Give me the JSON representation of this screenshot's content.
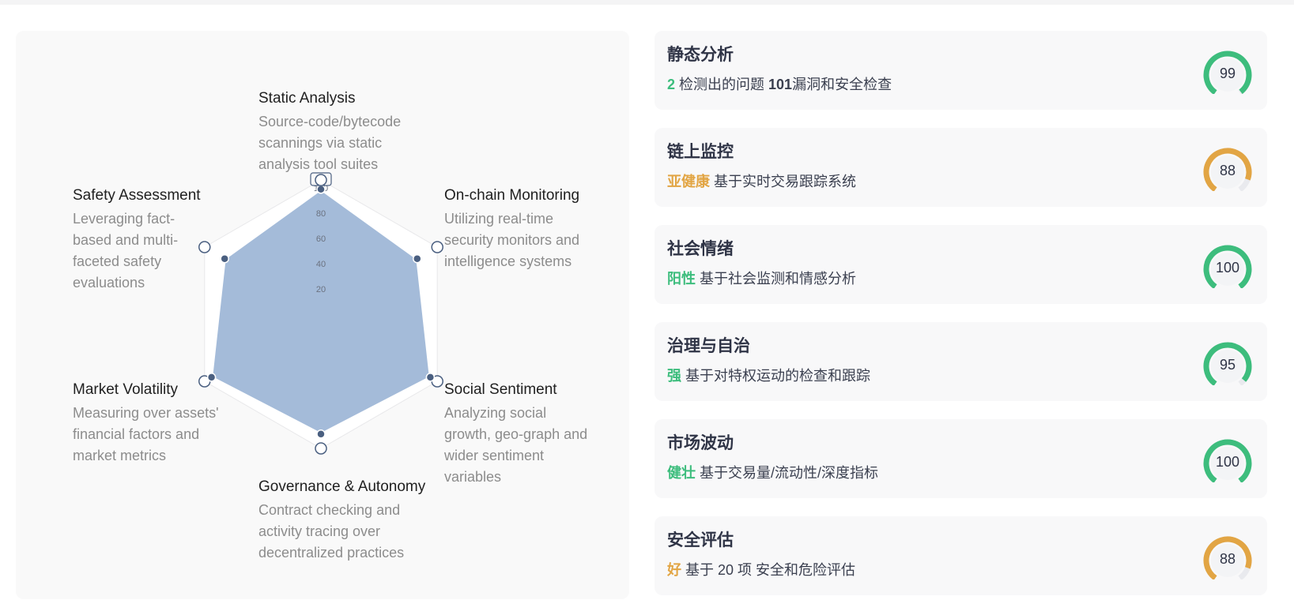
{
  "colors": {
    "green": "#3dbd7d",
    "orange": "#e2a544",
    "radar_fill": "#a4bbd9",
    "point": "#4a5f80"
  },
  "radar": {
    "scale_labels": [
      "20",
      "40",
      "60",
      "80",
      "100"
    ],
    "scale_max": 100,
    "dimensions": [
      {
        "title": "Static Analysis",
        "desc": [
          "Source-code/bytecode",
          "scannings via static",
          "analysis tool suites"
        ],
        "value": 99
      },
      {
        "title": "On-chain Monitoring",
        "desc": [
          "Utilizing real-time",
          "security monitors and",
          "intelligence systems"
        ],
        "value": 88
      },
      {
        "title": "Social Sentiment",
        "desc": [
          "Analyzing social",
          "growth, geo-graph and",
          "wider sentiment",
          "variables"
        ],
        "value": 100
      },
      {
        "title": "Governance & Autonomy",
        "desc": [
          "Contract checking and",
          "activity tracing over",
          "decentralized practices"
        ],
        "value": 95
      },
      {
        "title": "Market Volatility",
        "desc": [
          "Measuring over assets'",
          "financial factors and",
          "market metrics"
        ],
        "value": 100
      },
      {
        "title": "Safety Assessment",
        "desc": [
          "Leveraging fact-",
          "based and multi-",
          "faceted safety",
          "evaluations"
        ],
        "value": 88
      }
    ]
  },
  "cards": [
    {
      "title": "静态分析",
      "highlight": "2",
      "highlight_color": "green",
      "middle": " 检测出的问题 ",
      "number": "101",
      "rest": "漏洞和安全检查",
      "score": "99",
      "score_value": 99,
      "color": "green"
    },
    {
      "title": "链上监控",
      "highlight": "亚健康",
      "highlight_color": "orange",
      "middle": " 基于实时交易跟踪系统",
      "number": "",
      "rest": "",
      "score": "88",
      "score_value": 88,
      "color": "orange"
    },
    {
      "title": "社会情绪",
      "highlight": "阳性",
      "highlight_color": "green",
      "middle": " 基于社会监测和情感分析",
      "number": "",
      "rest": "",
      "score": "100",
      "score_value": 100,
      "color": "green"
    },
    {
      "title": "治理与自治",
      "highlight": "强",
      "highlight_color": "green",
      "middle": " 基于对特权运动的检查和跟踪",
      "number": "",
      "rest": "",
      "score": "95",
      "score_value": 95,
      "color": "green"
    },
    {
      "title": "市场波动",
      "highlight": "健壮",
      "highlight_color": "green",
      "middle": " 基于交易量/流动性/深度指标",
      "number": "",
      "rest": "",
      "score": "100",
      "score_value": 100,
      "color": "green"
    },
    {
      "title": "安全评估",
      "highlight": "好",
      "highlight_color": "orange",
      "middle": " 基于 20 项 安全和危险评估",
      "number": "",
      "rest": "",
      "score": "88",
      "score_value": 88,
      "color": "orange"
    }
  ]
}
